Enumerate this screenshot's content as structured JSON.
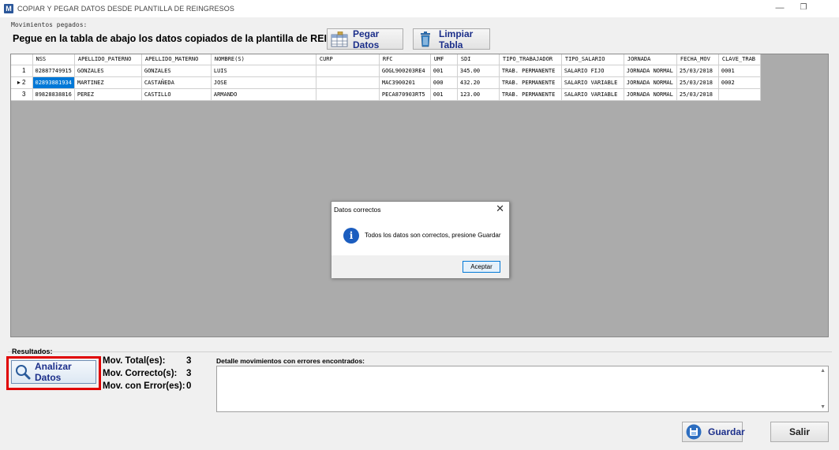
{
  "window": {
    "title": "COPIAR Y PEGAR DATOS DESDE PLANTILLA DE REINGRESOS",
    "icon_letter": "M",
    "minimize_glyph": "—",
    "restore_glyph": "❐"
  },
  "paste_group": {
    "label": "Movimientos pegados:",
    "heading": "Pegue en la tabla de abajo los datos copiados de la plantilla de REINGRESOS.",
    "paste_button": "Pegar Datos",
    "clear_button": "Limpiar Tabla"
  },
  "table": {
    "columns": [
      "NSS",
      "APELLIDO_PATERNO",
      "APELLIDO_MATERNO",
      "NOMBRE(S)",
      "CURP",
      "RFC",
      "UMF",
      "SDI",
      "TIPO_TRABAJADOR",
      "TIPO_SALARIO",
      "JORNADA",
      "FECHA_MOV",
      "CLAVE_TRAB"
    ],
    "rows": [
      {
        "row_header": "1",
        "cells": [
          "02887749915",
          "GONZALES",
          "GONZALES",
          "LUIS",
          "",
          "GOGL900203RE4",
          "001",
          "345.00",
          "TRAB. PERMANENTE",
          "SALARIO FIJO",
          "JORNADA NORMAL",
          "25/03/2018",
          "0001"
        ]
      },
      {
        "row_header": "▸ 2",
        "cells": [
          "02893881934",
          "MARTINEZ",
          "CASTAÑEDA",
          "JOSE",
          "",
          "MAC3900201",
          "000",
          "432.20",
          "TRAB. PERMANENTE",
          "SALARIO VARIABLE",
          "JORNADA NORMAL",
          "25/03/2018",
          "0002"
        ]
      },
      {
        "row_header": "3",
        "cells": [
          "89828838816",
          "PEREZ",
          "CASTILLO",
          "ARMANDO",
          "",
          "PECA870903RT5",
          "001",
          "123.00",
          "TRAB. PERMANENTE",
          "SALARIO VARIABLE",
          "JORNADA NORMAL",
          "25/03/2018",
          ""
        ]
      }
    ]
  },
  "dialog": {
    "title": "Datos correctos",
    "close_glyph": "✕",
    "icon_glyph": "i",
    "message": "Todos los datos son correctos, presione Guardar",
    "ok_button": "Aceptar"
  },
  "results": {
    "label": "Resultados:",
    "analyze_button": "Analizar Datos",
    "total_label": "Mov. Total(es):",
    "total_value": "3",
    "correct_label": "Mov. Correcto(s):",
    "correct_value": "3",
    "error_label": "Mov. con Error(es):",
    "error_value": "0",
    "detail_label": "Detalle movimientos con errores encontrados:",
    "detail_text": "",
    "scroll_up_glyph": "▲",
    "scroll_down_glyph": "▼"
  },
  "footer": {
    "save_button": "Guardar",
    "exit_button": "Salir"
  },
  "colors": {
    "selected_cell": "#0078d7",
    "highlight_box": "#e00000",
    "button_text": "#1c2f8a",
    "grid_background": "#ababab"
  }
}
